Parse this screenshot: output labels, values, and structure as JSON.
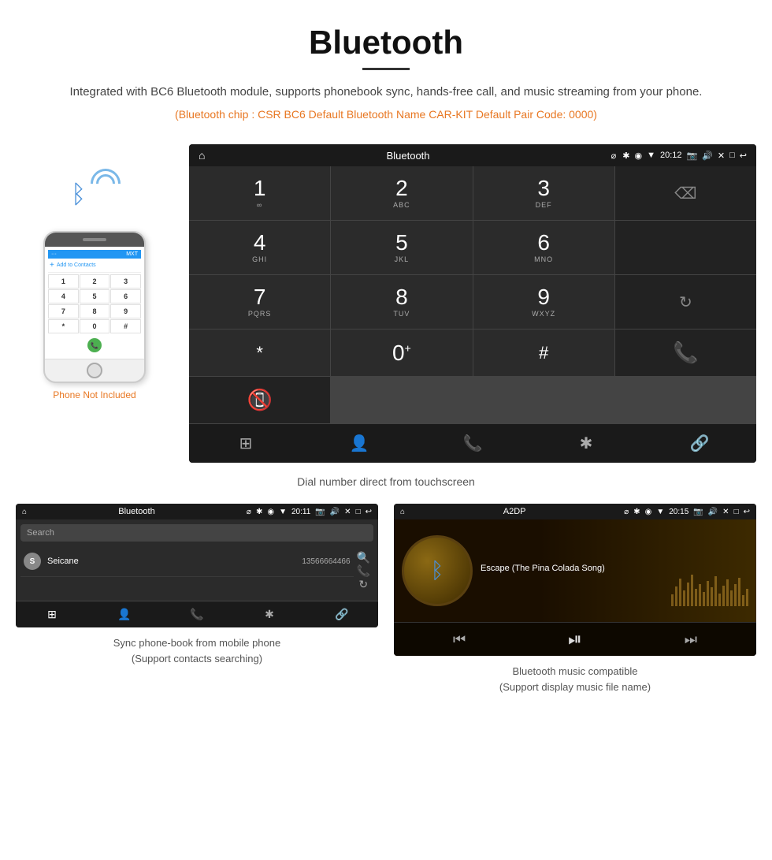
{
  "header": {
    "title": "Bluetooth",
    "description": "Integrated with BC6 Bluetooth module, supports phonebook sync, hands-free call, and music streaming from your phone.",
    "specs": "(Bluetooth chip : CSR BC6    Default Bluetooth Name CAR-KIT    Default Pair Code: 0000)"
  },
  "dialpad_screen": {
    "status_bar": {
      "title": "Bluetooth",
      "usb_symbol": "⌀",
      "time": "20:12",
      "icons": [
        "📷",
        "🔊",
        "✕",
        "□",
        "↩"
      ]
    },
    "keys": [
      {
        "num": "1",
        "letters": "∞"
      },
      {
        "num": "2",
        "letters": "ABC"
      },
      {
        "num": "3",
        "letters": "DEF"
      },
      {
        "special": "backspace"
      },
      {
        "num": "4",
        "letters": "GHI"
      },
      {
        "num": "5",
        "letters": "JKL"
      },
      {
        "num": "6",
        "letters": "MNO"
      },
      {
        "special": "empty"
      },
      {
        "num": "7",
        "letters": "PQRS"
      },
      {
        "num": "8",
        "letters": "TUV"
      },
      {
        "num": "9",
        "letters": "WXYZ"
      },
      {
        "special": "sync"
      },
      {
        "sym": "*"
      },
      {
        "num": "0",
        "letters": "+"
      },
      {
        "sym": "#"
      },
      {
        "special": "call-green"
      },
      {
        "special": "call-red"
      }
    ],
    "bottom_bar": [
      "⊞",
      "👤",
      "📞",
      "✱",
      "🔗"
    ],
    "caption": "Dial number direct from touchscreen"
  },
  "phone_illustration": {
    "not_included_text": "Phone Not Included"
  },
  "contacts_screen": {
    "status_bar": {
      "title": "Bluetooth",
      "time": "20:11"
    },
    "search_placeholder": "Search",
    "contacts": [
      {
        "initial": "S",
        "name": "Seicane",
        "number": "13566664466"
      }
    ],
    "caption_line1": "Sync phone-book from mobile phone",
    "caption_line2": "(Support contacts searching)"
  },
  "music_screen": {
    "status_bar": {
      "title": "A2DP",
      "time": "20:15"
    },
    "song_title": "Escape (The Pina Colada Song)",
    "caption_line1": "Bluetooth music compatible",
    "caption_line2": "(Support display music file name)"
  },
  "colors": {
    "accent_orange": "#e87722",
    "screen_bg": "#2b2b2b",
    "status_bg": "#1a1a1a",
    "call_green": "#4CAF50",
    "call_red": "#f44336"
  }
}
